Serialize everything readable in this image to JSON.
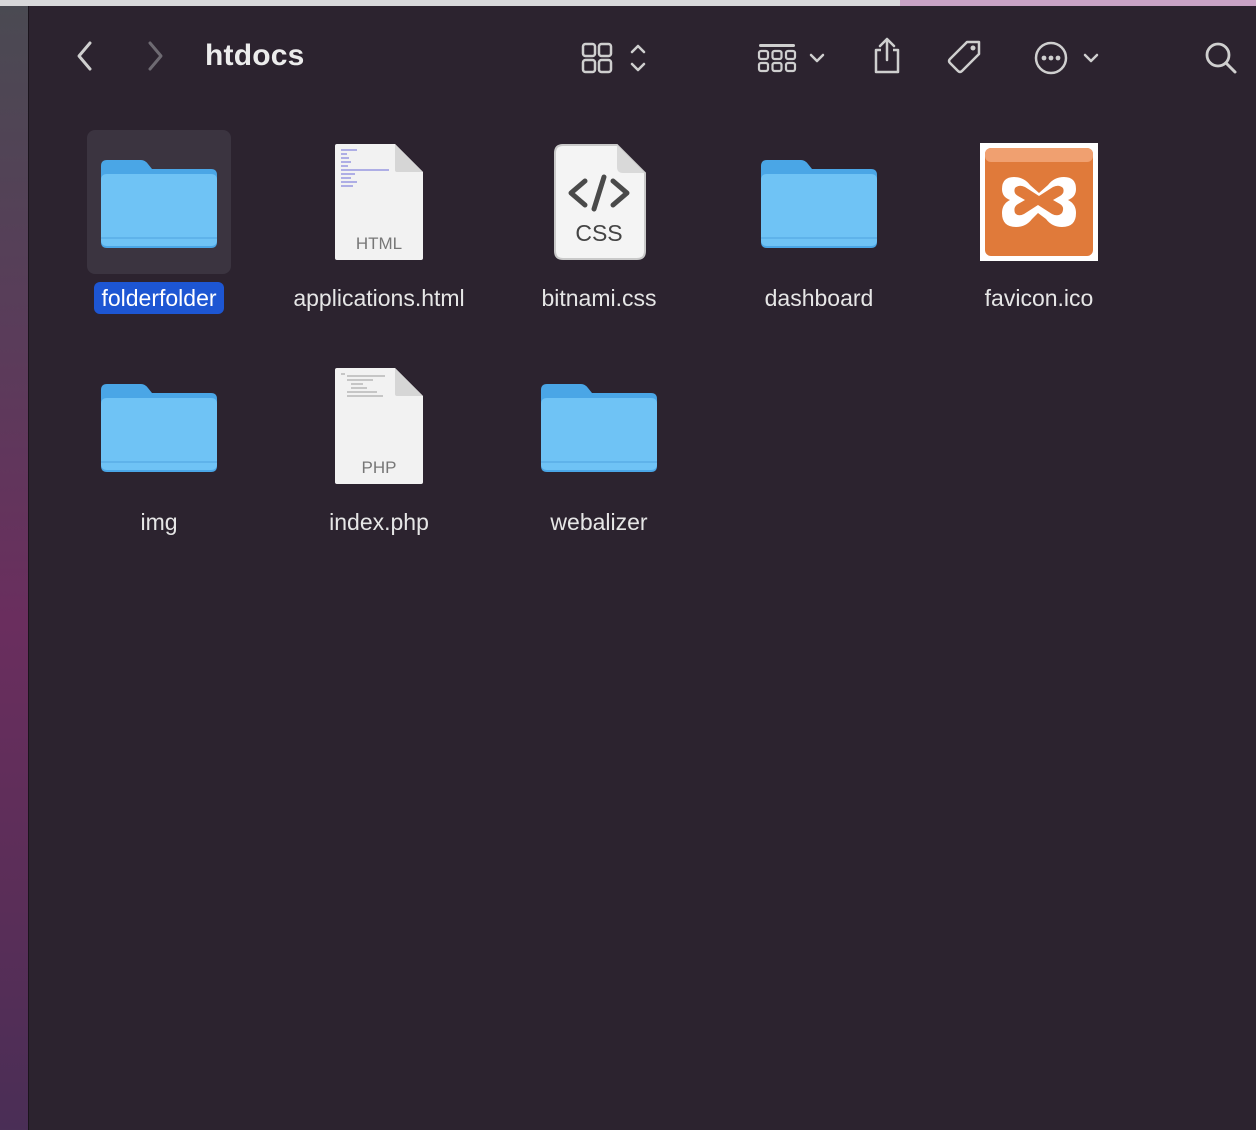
{
  "window": {
    "title": "htdocs"
  },
  "toolbar": {
    "back_icon": "chevron-left-icon",
    "forward_icon": "chevron-right-icon",
    "view_icon": "icon-grid-view-icon",
    "group_icon": "group-by-icon",
    "share_icon": "share-icon",
    "tag_icon": "tag-icon",
    "more_icon": "ellipsis-circle-icon",
    "search_icon": "search-icon"
  },
  "files": [
    {
      "name": "folderfolder",
      "kind": "folder",
      "selected": true
    },
    {
      "name": "applications.html",
      "kind": "html",
      "badge": "HTML"
    },
    {
      "name": "bitnami.css",
      "kind": "css",
      "badge": "CSS"
    },
    {
      "name": "dashboard",
      "kind": "folder"
    },
    {
      "name": "favicon.ico",
      "kind": "ico"
    },
    {
      "name": "img",
      "kind": "folder"
    },
    {
      "name": "index.php",
      "kind": "php",
      "badge": "PHP"
    },
    {
      "name": "webalizer",
      "kind": "folder"
    }
  ],
  "colors": {
    "window_bg": "#2c232f",
    "selection": "#1d56d3",
    "folder": "#6fc3f5",
    "xampp_orange": "#e07a3a"
  }
}
